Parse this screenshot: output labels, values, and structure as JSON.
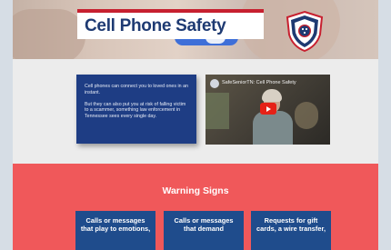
{
  "header": {
    "title": "Cell Phone Safety",
    "logo_icon": "shield-badge-icon",
    "colors": {
      "title": "#1e3a72",
      "accent": "#c7202f"
    }
  },
  "intro": {
    "paragraph_1": "Cell phones can connect you to loved ones in an instant.",
    "paragraph_2": "But they can also put you at risk of falling victim to a scammer, something law enforcement in Tennessee sees every single day."
  },
  "video": {
    "title": "SafeSeniorTN: Cell Phone Safety",
    "play_icon": "play-icon"
  },
  "warning_section": {
    "heading": "Warning Signs",
    "cards": [
      {
        "text": "Calls or messages that play to emotions,"
      },
      {
        "text": "Calls or messages that demand"
      },
      {
        "text": "Requests for gift cards, a wire transfer,"
      }
    ],
    "colors": {
      "background": "#f0585a",
      "card": "#1f4c8c"
    }
  }
}
